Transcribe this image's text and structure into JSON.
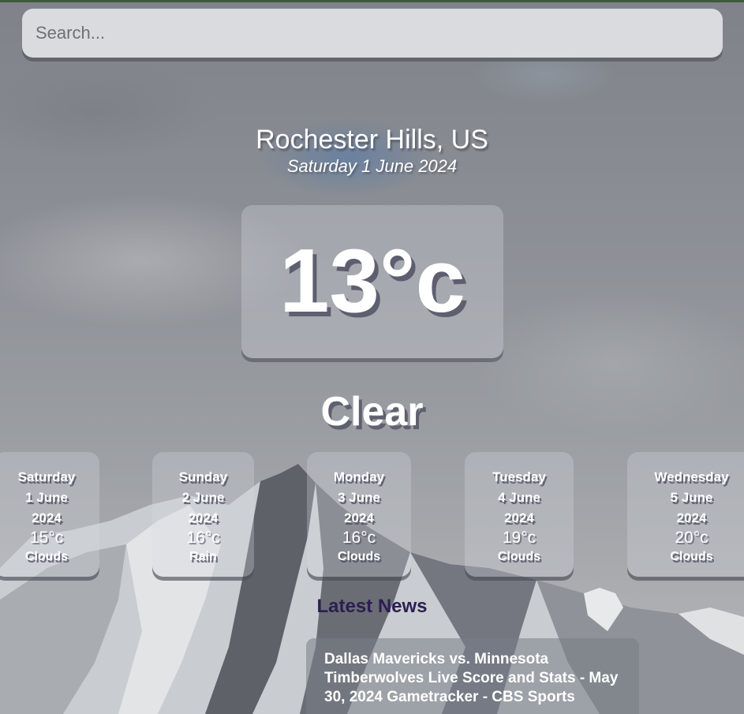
{
  "search": {
    "placeholder": "Search..."
  },
  "location": {
    "name": "Rochester Hills, US",
    "date": "Saturday 1 June 2024"
  },
  "current": {
    "temperature": "13°c",
    "condition": "Clear"
  },
  "forecast": [
    {
      "day": "Saturday",
      "date_line": "1 June",
      "year": "2024",
      "temp": "15°c",
      "condition": "Clouds"
    },
    {
      "day": "Sunday",
      "date_line": "2 June",
      "year": "2024",
      "temp": "16°c",
      "condition": "Rain"
    },
    {
      "day": "Monday",
      "date_line": "3 June",
      "year": "2024",
      "temp": "16°c",
      "condition": "Clouds"
    },
    {
      "day": "Tuesday",
      "date_line": "4 June",
      "year": "2024",
      "temp": "19°c",
      "condition": "Clouds"
    },
    {
      "day": "Wednesday",
      "date_line": "5 June",
      "year": "2024",
      "temp": "20°c",
      "condition": "Clouds"
    }
  ],
  "news": {
    "heading": "Latest News",
    "articles": [
      {
        "title": "Dallas Mavericks vs. Minnesota Timberwolves Live Score and Stats - May 30, 2024 Gametracker - CBS Sports"
      }
    ]
  },
  "colors": {
    "news_heading": "#2d1e52",
    "text": "#ffffff"
  }
}
